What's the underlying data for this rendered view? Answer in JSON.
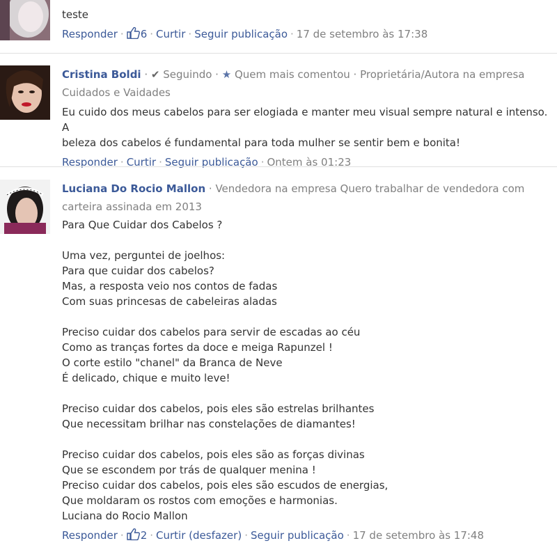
{
  "comments": [
    {
      "text": "teste",
      "actions": {
        "reply": "Responder",
        "likes": "6",
        "like": "Curtir",
        "follow": "Seguir publicação",
        "time": "17 de setembro às 17:38"
      }
    },
    {
      "author": "Cristina Boldi",
      "following": "Seguindo",
      "top_commenter": "Quem mais comentou",
      "role_line1": "Proprietária/Autora na empresa",
      "role_line2": "Cuidados e Vaidades",
      "text": "Eu cuido dos meus cabelos para ser elogiada e manter meu visual sempre natural e intenso. A\nbeleza dos cabelos é fundamental para toda mulher se sentir bem e bonita!",
      "actions": {
        "reply": "Responder",
        "like": "Curtir",
        "follow": "Seguir publicação",
        "time": "Ontem às 01:23"
      }
    },
    {
      "author": "Luciana Do Rocio Mallon",
      "role_line1": "Vendedora na empresa Quero trabalhar de vendedora com",
      "role_line2": "carteira assinada em 2013",
      "text": "Para Que Cuidar dos Cabelos ?\n\nUma vez, perguntei de joelhos:\nPara que cuidar dos cabelos?\nMas, a resposta veio nos contos de fadas\nCom suas princesas de cabeleiras aladas\n\nPreciso cuidar dos cabelos para servir de escadas ao céu\nComo as tranças fortes da doce e meiga Rapunzel !\nO corte estilo \"chanel\" da Branca de Neve\nÉ delicado, chique e muito leve!\n\nPreciso cuidar dos cabelos, pois eles são estrelas brilhantes\nQue necessitam brilhar nas constelações de diamantes!\n\nPreciso cuidar dos cabelos, pois eles são as forças divinas\nQue se escondem por trás de qualquer menina !\nPreciso cuidar dos cabelos, pois eles são escudos de energias,\nQue moldaram os rostos com emoções e harmonias.\nLuciana do Rocio Mallon",
      "actions": {
        "reply": "Responder",
        "likes": "2",
        "like": "Curtir (desfazer)",
        "follow": "Seguir publicação",
        "time": "17 de setembro às 17:48"
      }
    }
  ],
  "colors": {
    "link": "#3b5998",
    "meta": "#808080",
    "text": "#333333",
    "separator": "#e0e0e0"
  }
}
